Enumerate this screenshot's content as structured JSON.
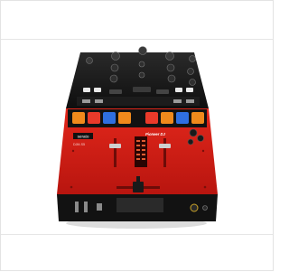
{
  "product": {
    "brand_badge": "serato",
    "model_label": "DJM-S5",
    "logo_text": "Pioneer DJ",
    "colors": {
      "body_red": "#d81f16",
      "body_red_dark": "#a8140e",
      "top_black": "#151515",
      "pad_orange": "#f08a1c",
      "pad_red": "#ea3a2a",
      "pad_blue": "#2f6fe0"
    },
    "pads_left": [
      "pad-orange",
      "pad-red",
      "pad-blue",
      "pad-orange"
    ],
    "pads_right": [
      "pad-red",
      "pad-orange",
      "pad-blue",
      "pad-orange"
    ]
  }
}
